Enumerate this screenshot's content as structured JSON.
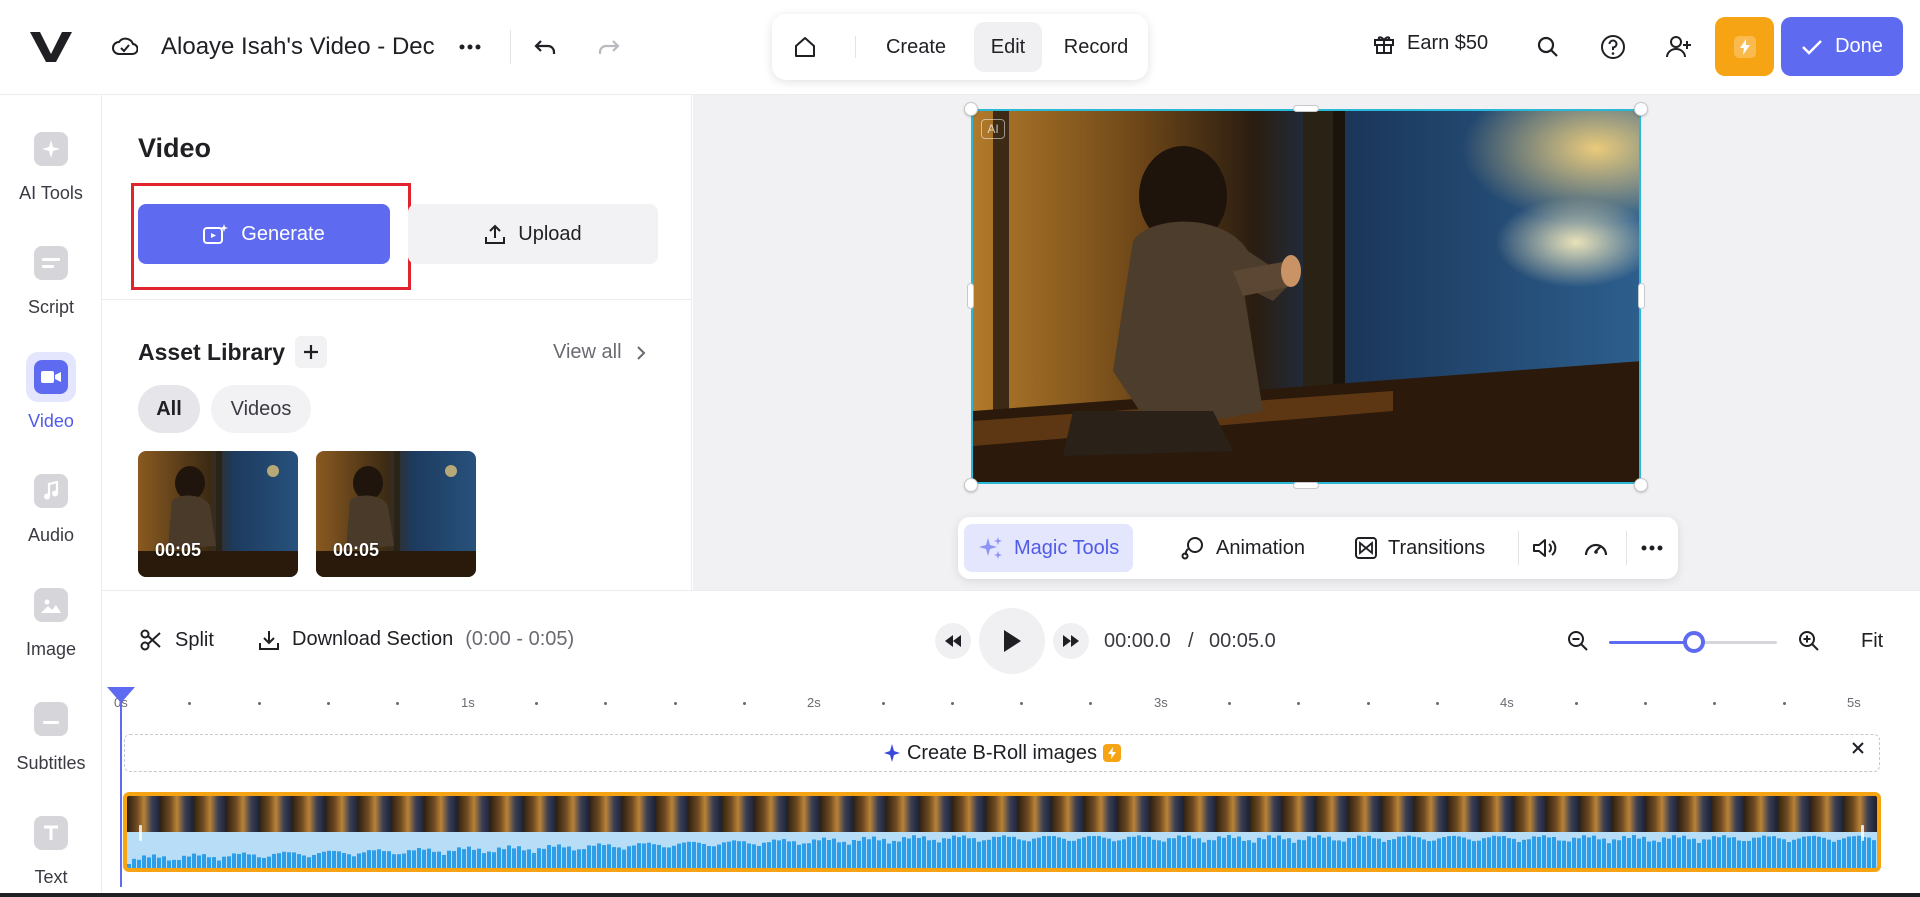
{
  "header": {
    "project_title": "Aloaye Isah's Video - Dec",
    "modes": [
      {
        "label": "Create",
        "active": false
      },
      {
        "label": "Edit",
        "active": true
      },
      {
        "label": "Record",
        "active": false
      }
    ],
    "earn_label": "Earn $50",
    "done_label": "Done"
  },
  "sidebar": {
    "items": [
      {
        "label": "AI Tools",
        "icon": "sparkle-icon",
        "active": false
      },
      {
        "label": "Script",
        "icon": "script-icon",
        "active": false
      },
      {
        "label": "Video",
        "icon": "video-camera-icon",
        "active": true
      },
      {
        "label": "Audio",
        "icon": "music-note-icon",
        "active": false
      },
      {
        "label": "Image",
        "icon": "image-icon",
        "active": false
      },
      {
        "label": "Subtitles",
        "icon": "subtitles-icon",
        "active": false
      },
      {
        "label": "Text",
        "icon": "text-icon",
        "active": false
      }
    ]
  },
  "panel": {
    "title": "Video",
    "generate_label": "Generate",
    "upload_label": "Upload",
    "library_title": "Asset Library",
    "view_all_label": "View all",
    "filters": [
      {
        "label": "All",
        "active": true
      },
      {
        "label": "Videos",
        "active": false
      }
    ],
    "assets": [
      {
        "duration": "00:05"
      },
      {
        "duration": "00:05"
      }
    ]
  },
  "stage": {
    "ai_badge": "AI",
    "tools": [
      {
        "label": "Magic Tools",
        "icon": "sparkle-icon"
      },
      {
        "label": "Animation",
        "icon": "animation-icon"
      },
      {
        "label": "Transitions",
        "icon": "transitions-icon"
      }
    ]
  },
  "timeline": {
    "split_label": "Split",
    "download_label": "Download Section",
    "section_range": "(0:00 - 0:05)",
    "current_time": "00:00.0",
    "time_separator": "/",
    "total_time": "00:05.0",
    "fit_label": "Fit",
    "zoom_level": 0.5,
    "ruler_labels": [
      "0s",
      "1s",
      "2s",
      "3s",
      "4s",
      "5s"
    ],
    "broll_label": "Create B-Roll images"
  },
  "colors": {
    "accent": "#5e6bf0",
    "warning_orange": "#f7a414",
    "highlight_red": "#e0242d",
    "selection_cyan": "#2bb7d6"
  }
}
